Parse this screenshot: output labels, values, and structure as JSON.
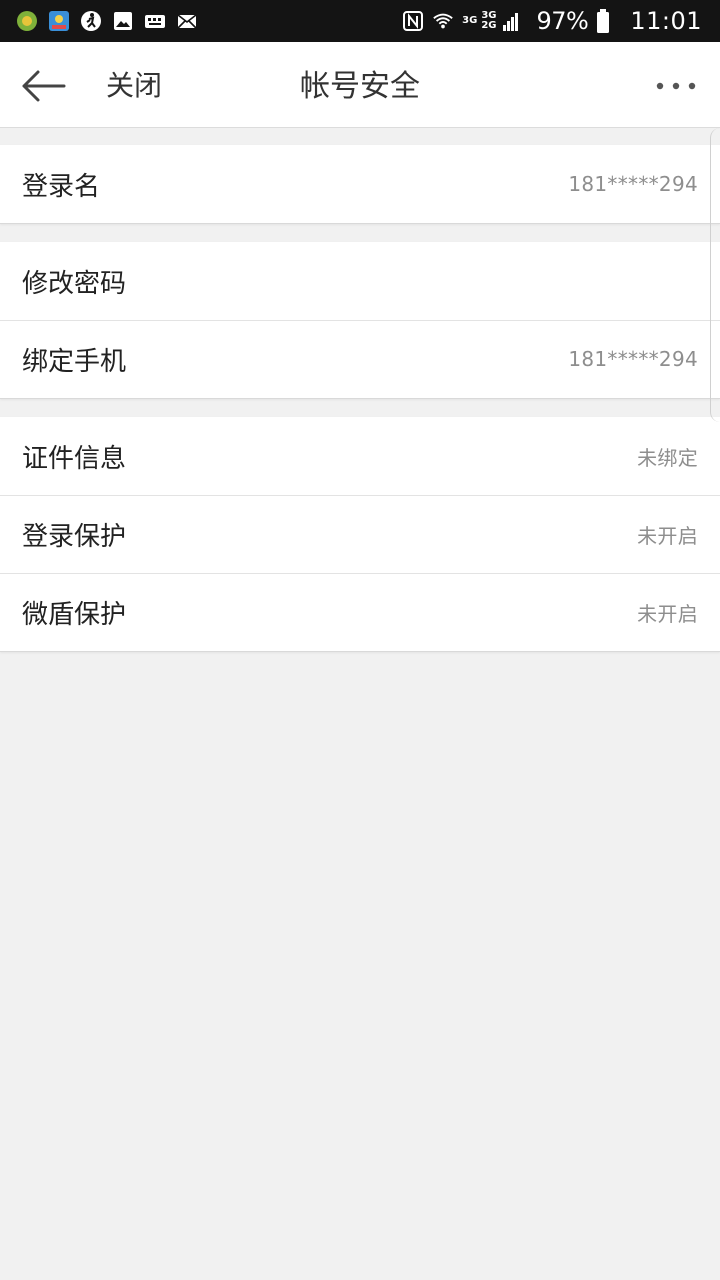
{
  "statusbar": {
    "left_icons": [
      "app-notification-icon",
      "photo-app-icon",
      "fitness-icon",
      "gallery-icon",
      "keyboard-icon",
      "mail-icon"
    ],
    "net_top": "3G",
    "net_mid": "3G",
    "net_bottom": "2G",
    "battery": "97%",
    "time": "11:01"
  },
  "navbar": {
    "close_label": "关闭",
    "title": "帐号安全"
  },
  "groups": [
    [
      {
        "label": "登录名",
        "value": "181*****294"
      }
    ],
    [
      {
        "label": "修改密码",
        "value": ""
      },
      {
        "label": "绑定手机",
        "value": "181*****294"
      }
    ],
    [
      {
        "label": "证件信息",
        "value": "未绑定"
      },
      {
        "label": "登录保护",
        "value": "未开启"
      },
      {
        "label": "微盾保护",
        "value": "未开启"
      }
    ]
  ],
  "colors": {
    "background": "#f1f1f1",
    "statusbar": "#141414",
    "text_primary": "#222222",
    "text_secondary": "#8e8e8e"
  }
}
